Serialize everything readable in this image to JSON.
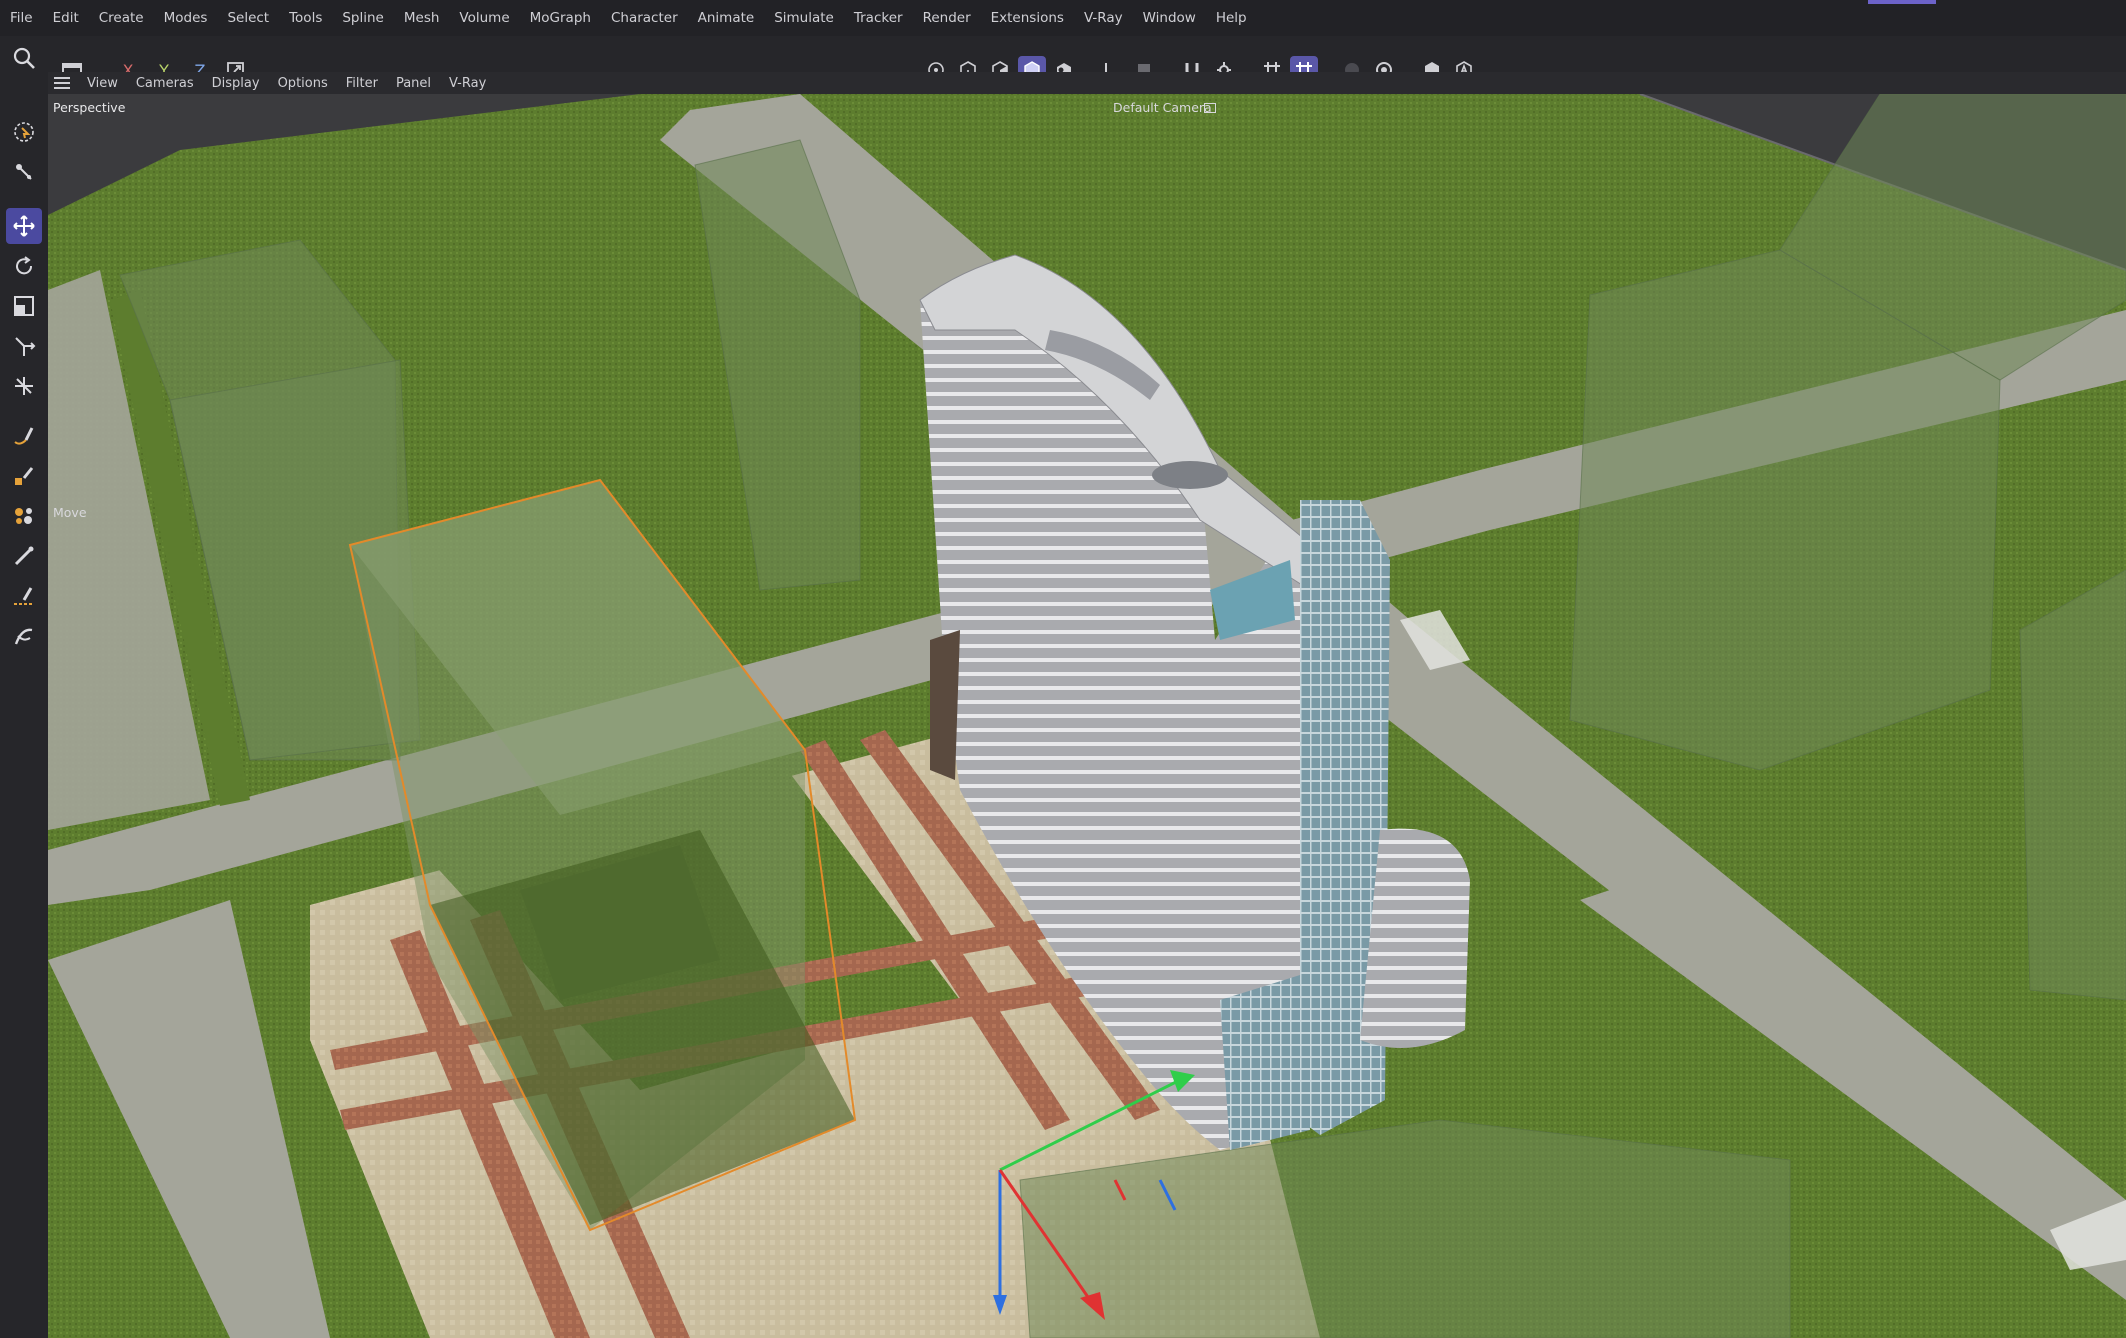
{
  "menu": [
    "File",
    "Edit",
    "Create",
    "Modes",
    "Select",
    "Tools",
    "Spline",
    "Mesh",
    "Volume",
    "MoGraph",
    "Character",
    "Animate",
    "Simulate",
    "Tracker",
    "Render",
    "Extensions",
    "V-Ray",
    "Window",
    "Help"
  ],
  "toolbar": {
    "axis_x": "X",
    "axis_y": "Y",
    "axis_z": "Z"
  },
  "viewport_menu": [
    "View",
    "Cameras",
    "Display",
    "Options",
    "Filter",
    "Panel",
    "V-Ray"
  ],
  "viewport": {
    "projection_label": "Perspective",
    "camera_label": "Default Camera",
    "tool_hint": "Move"
  },
  "colors": {
    "accent": "#5a57a8",
    "grass": "#5f7d2f",
    "road": "#a4a59a",
    "selection": "#e38a2a"
  },
  "icons": {
    "sidebar": [
      "search-icon",
      "select-tool-icon",
      "transform-icon",
      "move-icon",
      "rotate-icon",
      "scale-icon",
      "axis-move-icon",
      "snap-icon",
      "spline-pen-icon",
      "sculpt-icon",
      "paint-icon",
      "brush-icon",
      "knife-icon",
      "magnet-icon"
    ]
  }
}
